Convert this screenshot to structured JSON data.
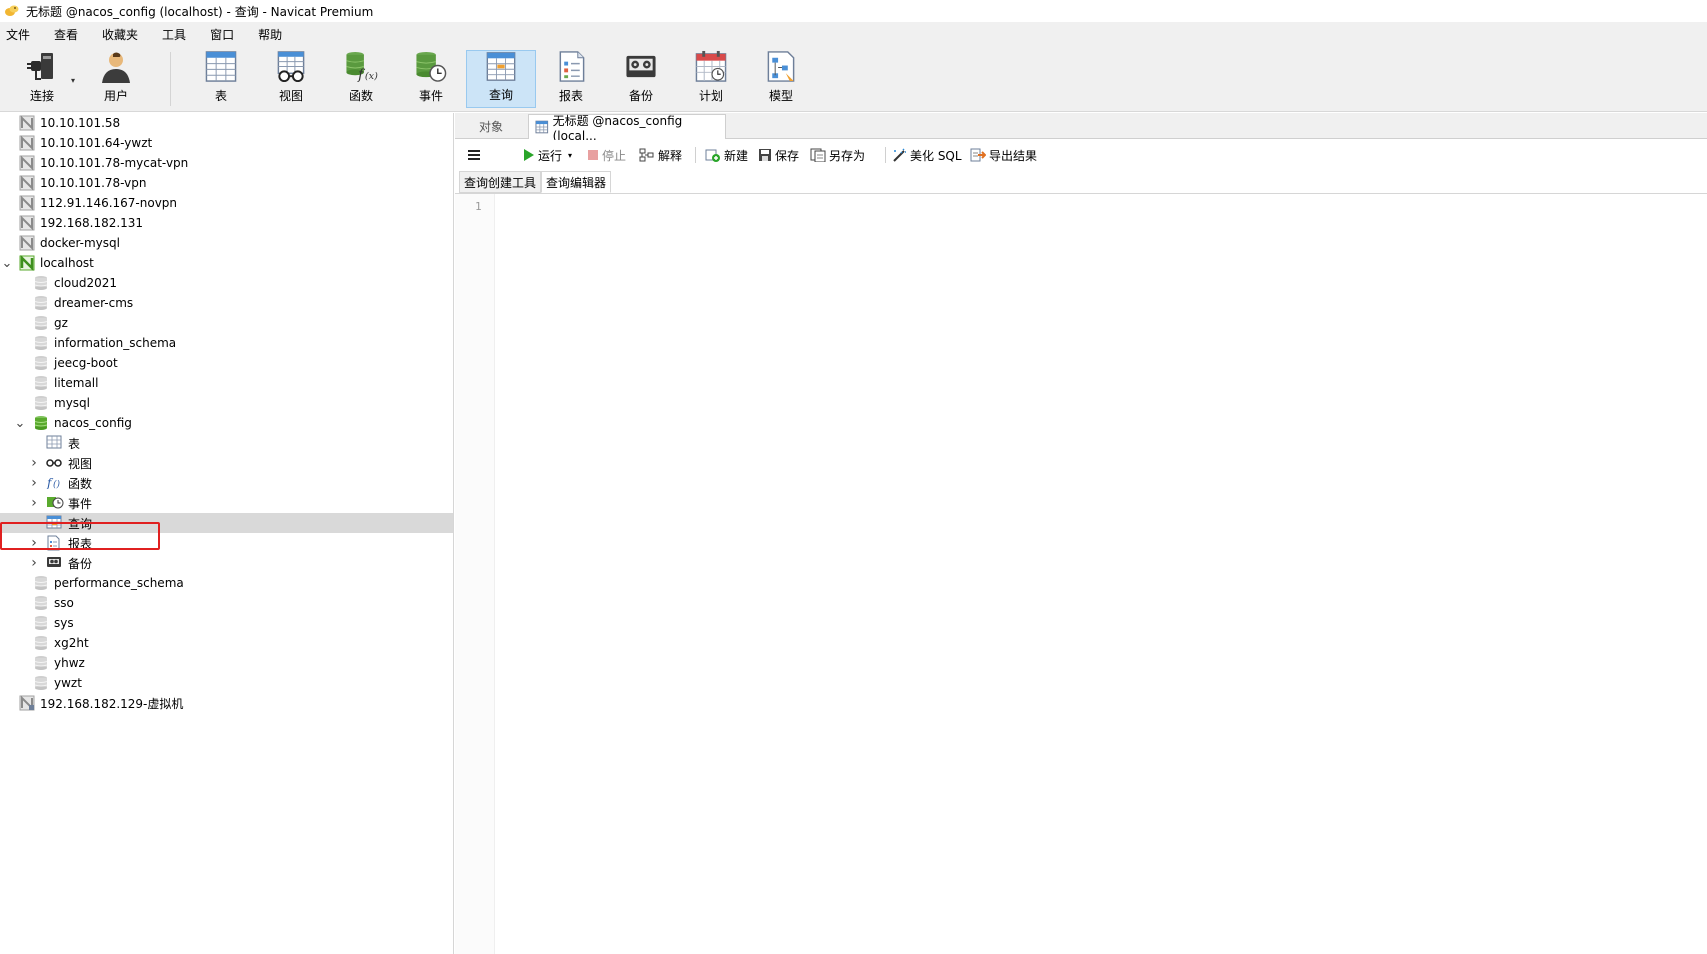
{
  "window": {
    "title": "无标题 @nacos_config (localhost) - 查询 - Navicat Premium"
  },
  "menu": [
    "文件",
    "查看",
    "收藏夹",
    "工具",
    "窗口",
    "帮助"
  ],
  "toolbar": {
    "connect": "连接",
    "user": "用户",
    "table": "表",
    "view": "视图",
    "function": "函数",
    "event": "事件",
    "query": "查询",
    "report": "报表",
    "backup": "备份",
    "schedule": "计划",
    "model": "模型",
    "active": "query"
  },
  "tree": {
    "connections_before": [
      "10.10.101.58",
      "10.10.101.64-ywzt",
      "10.10.101.78-mycat-vpn",
      "10.10.101.78-vpn",
      "112.91.146.167-novpn",
      "192.168.182.131",
      "docker-mysql"
    ],
    "open_connection": "localhost",
    "databases_before": [
      "cloud2021",
      "dreamer-cms",
      "gz",
      "information_schema",
      "jeecg-boot",
      "litemall",
      "mysql"
    ],
    "open_database": "nacos_config",
    "db_children": [
      "表",
      "视图",
      "函数",
      "事件",
      "查询",
      "报表",
      "备份"
    ],
    "selected_child": "查询",
    "databases_after": [
      "performance_schema",
      "sso",
      "sys",
      "xg2ht",
      "yhwz",
      "ywzt"
    ],
    "connections_after": [
      "192.168.182.129-虚拟机"
    ]
  },
  "tabs": {
    "objects": "对象",
    "query_tab": "无标题 @nacos_config (local..."
  },
  "query_toolbar": {
    "run": "运行",
    "stop": "停止",
    "explain": "解释",
    "new": "新建",
    "save": "保存",
    "save_as": "另存为",
    "beautify": "美化 SQL",
    "export": "导出结果"
  },
  "subtabs": {
    "builder": "查询创建工具",
    "editor": "查询编辑器"
  },
  "editor": {
    "line_number": "1"
  },
  "colors": {
    "active_tool": "#cce4f7",
    "selection_box": "#e02020",
    "db_open": "#5aaa2e",
    "run_green": "#2aa52a"
  }
}
